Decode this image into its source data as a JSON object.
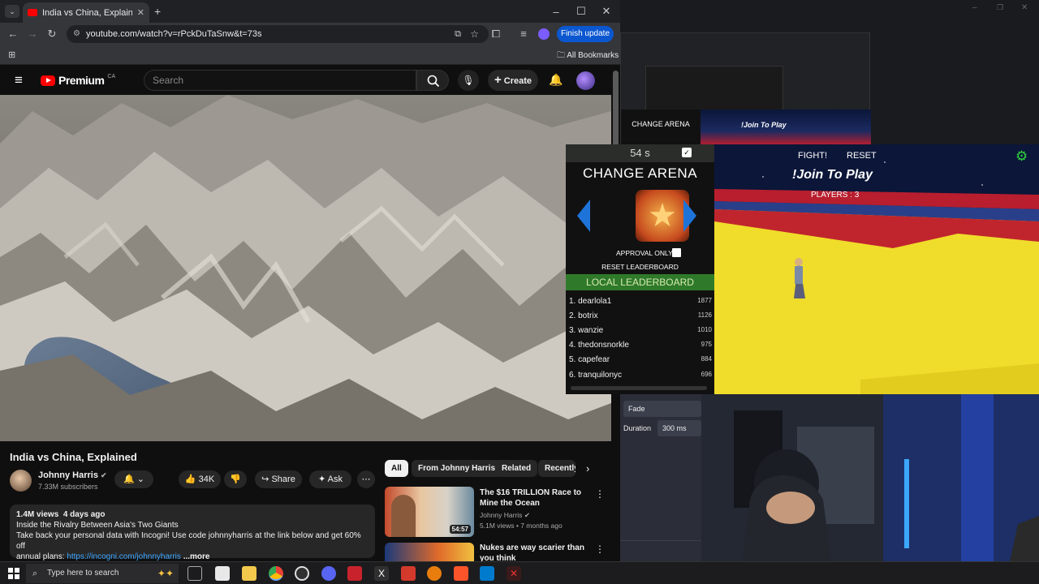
{
  "browser": {
    "tab_title": "India vs China, Explained - YouTube",
    "url": "youtube.com/watch?v=rPckDuTaSnw&t=73s",
    "finish_update": "Finish update",
    "all_bookmarks": "All Bookmarks"
  },
  "youtube": {
    "logo_text": "Premium",
    "region": "CA",
    "search_placeholder": "Search",
    "create_label": "Create",
    "video_title": "India vs China, Explained",
    "channel_name": "Johnny Harris",
    "subscribers": "7.33M subscribers",
    "likes": "34K",
    "share_label": "Share",
    "ask_label": "Ask",
    "views": "1.4M views",
    "posted": "4 days ago",
    "desc_line1": "Inside the Rivalry Between Asia's Two Giants",
    "desc_line2": "Take back your personal data with Incogni! Use code johnnyharris at the link below and get 60% off",
    "desc_line3_prefix": "annual plans: ",
    "desc_link": "https://incogni.com/johnnyharris",
    "more_label": "...more",
    "chips": [
      "All",
      "From Johnny Harris",
      "Related",
      "Recently"
    ],
    "recommendations": [
      {
        "title": "The $16 TRILLION Race to Mine the Ocean",
        "channel": "Johnny Harris",
        "meta": "5.1M views • 7 months ago",
        "duration": "54:57"
      },
      {
        "title": "Nukes are way scarier than you think",
        "channel": "",
        "meta": "",
        "duration": ""
      }
    ]
  },
  "game": {
    "timer": "54 s",
    "change_arena": "CHANGE ARENA",
    "approval_only": "APPROVAL ONLY",
    "reset_leaderboard": "RESET LEADERBOARD",
    "local_leaderboard": "LOCAL LEADERBOARD",
    "leaderboard": [
      {
        "name": "1. dearlola1",
        "score": "1877"
      },
      {
        "name": "2. botrix",
        "score": "1126"
      },
      {
        "name": "3. wanzie",
        "score": "1010"
      },
      {
        "name": "4. thedonsnorkle",
        "score": "975"
      },
      {
        "name": "5. capefear",
        "score": "884"
      },
      {
        "name": "6. tranquilonyc",
        "score": "696"
      }
    ],
    "fight_label": "FIGHT!",
    "reset_label": "RESET",
    "join_text": "!Join To Play",
    "players": "PLAYERS : 3",
    "colors": {
      "floor": "#f0dc2a",
      "edge": "#b81e2e",
      "sky": "#0b1638",
      "panel": "#111111",
      "leaderboard_bar": "#2f7a2a"
    }
  },
  "obs": {
    "fade_label": "Fade",
    "duration_label": "Duration",
    "duration_value": "300 ms"
  },
  "taskbar": {
    "search_placeholder": "Type here to search"
  }
}
